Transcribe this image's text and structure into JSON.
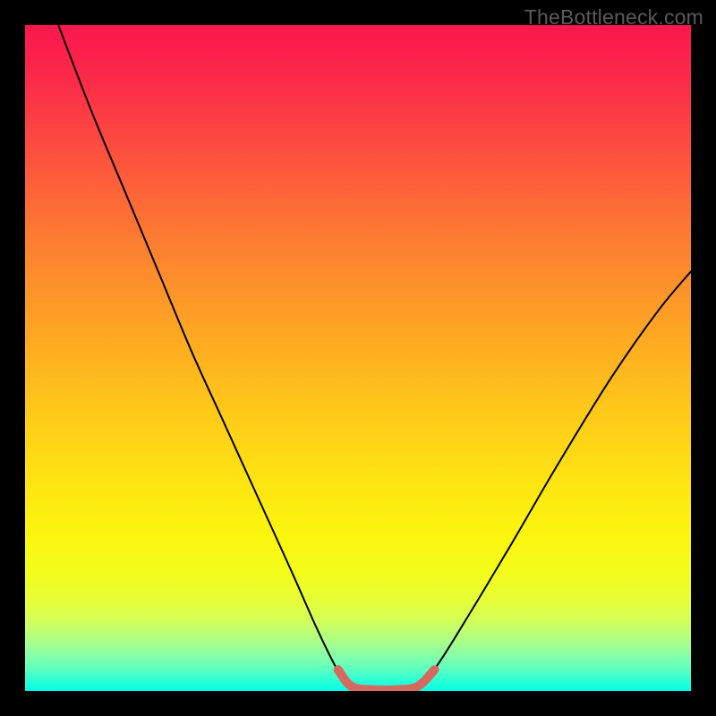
{
  "watermark": "TheBottleneck.com",
  "chart_data": {
    "type": "line",
    "title": "",
    "xlabel": "",
    "ylabel": "",
    "xlim": [
      0,
      100
    ],
    "ylim": [
      0,
      100
    ],
    "gradient_stops": [
      {
        "pos": 0,
        "color": "#fb174f"
      },
      {
        "pos": 8,
        "color": "#fb2a49"
      },
      {
        "pos": 18,
        "color": "#fc4c3f"
      },
      {
        "pos": 28,
        "color": "#fd6e35"
      },
      {
        "pos": 38,
        "color": "#fd8e2b"
      },
      {
        "pos": 48,
        "color": "#feac21"
      },
      {
        "pos": 58,
        "color": "#fec919"
      },
      {
        "pos": 68,
        "color": "#fee312"
      },
      {
        "pos": 76,
        "color": "#fbf50e"
      },
      {
        "pos": 82,
        "color": "#f4fc1a"
      },
      {
        "pos": 86,
        "color": "#e8fe35"
      },
      {
        "pos": 89,
        "color": "#d7ff53"
      },
      {
        "pos": 91,
        "color": "#c0ff72"
      },
      {
        "pos": 93,
        "color": "#a3ff90"
      },
      {
        "pos": 95,
        "color": "#80ffab"
      },
      {
        "pos": 97,
        "color": "#57ffc2"
      },
      {
        "pos": 98.5,
        "color": "#2affd6"
      },
      {
        "pos": 100,
        "color": "#00ffe6"
      }
    ],
    "series": [
      {
        "name": "bottleneck-curve",
        "color": "#000000",
        "stroke_width": 2,
        "points": [
          {
            "x": 5,
            "y": 100
          },
          {
            "x": 10,
            "y": 87
          },
          {
            "x": 15,
            "y": 75
          },
          {
            "x": 20,
            "y": 63
          },
          {
            "x": 25,
            "y": 51
          },
          {
            "x": 30,
            "y": 40
          },
          {
            "x": 35,
            "y": 29
          },
          {
            "x": 40,
            "y": 18
          },
          {
            "x": 44,
            "y": 9
          },
          {
            "x": 47,
            "y": 3
          },
          {
            "x": 49,
            "y": 0.5
          },
          {
            "x": 52,
            "y": 0
          },
          {
            "x": 56,
            "y": 0
          },
          {
            "x": 59,
            "y": 0.5
          },
          {
            "x": 62,
            "y": 4
          },
          {
            "x": 67,
            "y": 12
          },
          {
            "x": 73,
            "y": 22
          },
          {
            "x": 80,
            "y": 34
          },
          {
            "x": 88,
            "y": 47
          },
          {
            "x": 95,
            "y": 57
          },
          {
            "x": 100,
            "y": 63
          }
        ]
      },
      {
        "name": "bottom-highlight",
        "color": "#d46a5f",
        "stroke_width": 10,
        "points": [
          {
            "x": 47,
            "y": 3.2
          },
          {
            "x": 49,
            "y": 0.7
          },
          {
            "x": 52,
            "y": 0.2
          },
          {
            "x": 56,
            "y": 0.2
          },
          {
            "x": 59,
            "y": 0.7
          },
          {
            "x": 61.5,
            "y": 3.2
          }
        ]
      }
    ]
  }
}
